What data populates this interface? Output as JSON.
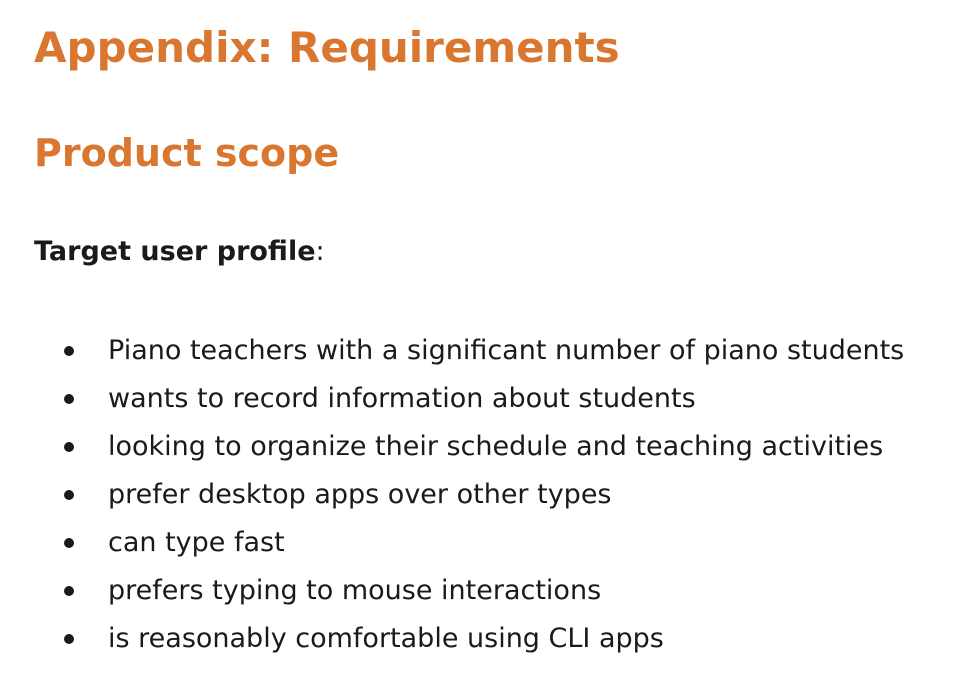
{
  "heading": "Appendix: Requirements",
  "subheading": "Product scope",
  "profile": {
    "label": "Target user profile",
    "suffix": ":"
  },
  "items": [
    "Piano teachers with a significant number of piano students",
    "wants to record information about students",
    "looking to organize their schedule and teaching activities",
    "prefer desktop apps over other types",
    "can type fast",
    "prefers typing to mouse interactions",
    "is reasonably comfortable using CLI apps"
  ],
  "colors": {
    "heading": "#d9762f",
    "text": "#1a1a1a"
  }
}
